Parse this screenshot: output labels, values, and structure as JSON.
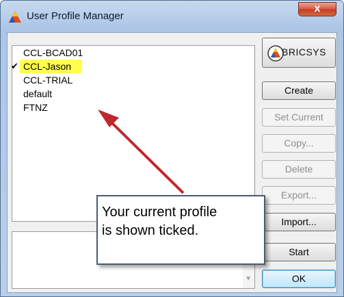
{
  "window": {
    "title": "User Profile Manager",
    "close_label": "x"
  },
  "logo": {
    "text": "BRICSYS"
  },
  "profiles": [
    {
      "name": "CCL-BCAD01",
      "current": false
    },
    {
      "name": "CCL-Jason",
      "current": true
    },
    {
      "name": "CCL-TRIAL",
      "current": false
    },
    {
      "name": "default",
      "current": false
    },
    {
      "name": "FTNZ",
      "current": false
    }
  ],
  "checkmark": "✔",
  "buttons": {
    "create": "Create",
    "set_current": "Set Current",
    "copy": "Copy...",
    "delete": "Delete",
    "export": "Export...",
    "import": "Import...",
    "start": "Start",
    "ok": "OK"
  },
  "callout": {
    "line1": "Your current profile",
    "line2": "is shown ticked."
  },
  "colors": {
    "highlight": "#ffff4a",
    "arrow": "#c0272d"
  }
}
